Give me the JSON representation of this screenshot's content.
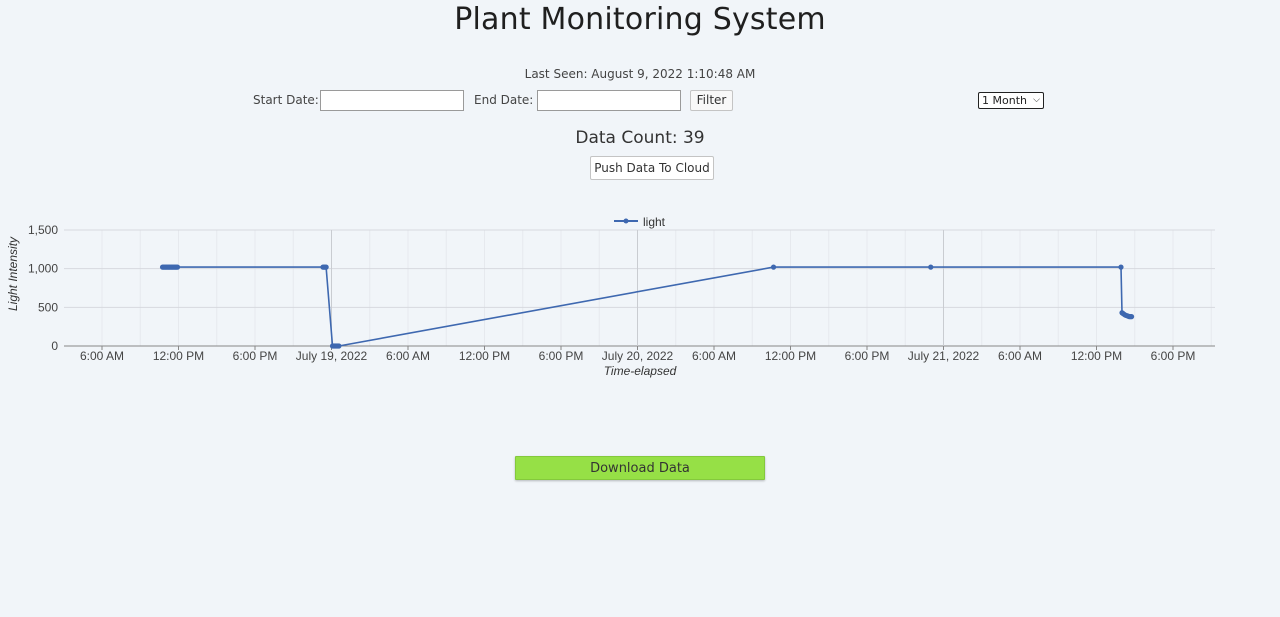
{
  "header": {
    "title": "Plant Monitoring System",
    "last_seen": "Last Seen: August 9, 2022 1:10:48 AM"
  },
  "filters": {
    "start_label": "Start Date:",
    "end_label": "End Date:",
    "start_value": "",
    "end_value": "",
    "filter_label": "Filter",
    "range_selected": "1 Month"
  },
  "data_count": "Data Count: 39",
  "push_label": "Push Data To Cloud",
  "download_label": "Download Data",
  "colors": {
    "line": "#3e68b0",
    "download": "#96e046"
  },
  "chart_data": {
    "type": "line",
    "xlabel": "Time-elapsed",
    "ylabel": "Light Intensity",
    "ylim": [
      0,
      1500
    ],
    "yticks": [
      0,
      500,
      1000,
      1500
    ],
    "ytick_labels": [
      "0",
      "500",
      "1,000",
      "1,500"
    ],
    "xlim_hours": [
      0,
      66
    ],
    "xticks": [
      {
        "h": 6,
        "label": "6:00 AM"
      },
      {
        "h": 12,
        "label": "12:00 PM"
      },
      {
        "h": 18,
        "label": "6:00 PM"
      },
      {
        "h": 24,
        "label": "July 19, 2022",
        "major": true
      },
      {
        "h": 30,
        "label": "6:00 AM"
      },
      {
        "h": 36,
        "label": "12:00 PM"
      },
      {
        "h": 42,
        "label": "6:00 PM"
      },
      {
        "h": 48,
        "label": "July 20, 2022",
        "major": true
      },
      {
        "h": 54,
        "label": "6:00 AM"
      },
      {
        "h": 60,
        "label": "12:00 PM"
      },
      {
        "h": 66,
        "label": "6:00 PM"
      },
      {
        "h": 72,
        "label": "July 21, 2022",
        "major": true
      },
      {
        "h": 78,
        "label": "6:00 AM"
      },
      {
        "h": 84,
        "label": "12:00 PM"
      },
      {
        "h": 90,
        "label": "6:00 PM"
      }
    ],
    "legend": {
      "position": "top-center"
    },
    "series": [
      {
        "name": "light",
        "points": [
          {
            "x": "July 18, 2022 10:45 AM",
            "h": 10.75,
            "y": 1020
          },
          {
            "x": "July 18, 2022 10:50 AM",
            "h": 10.83,
            "y": 1020
          },
          {
            "x": "July 18, 2022 10:55 AM",
            "h": 10.92,
            "y": 1020
          },
          {
            "x": "July 18, 2022 11:00 AM",
            "h": 11.0,
            "y": 1020
          },
          {
            "x": "July 18, 2022 11:05 AM",
            "h": 11.08,
            "y": 1020
          },
          {
            "x": "July 18, 2022 11:10 AM",
            "h": 11.17,
            "y": 1020
          },
          {
            "x": "July 18, 2022 11:15 AM",
            "h": 11.25,
            "y": 1020
          },
          {
            "x": "July 18, 2022 11:20 AM",
            "h": 11.33,
            "y": 1020
          },
          {
            "x": "July 18, 2022 11:25 AM",
            "h": 11.42,
            "y": 1020
          },
          {
            "x": "July 18, 2022 11:30 AM",
            "h": 11.5,
            "y": 1020
          },
          {
            "x": "July 18, 2022 11:35 AM",
            "h": 11.58,
            "y": 1020
          },
          {
            "x": "July 18, 2022 11:40 AM",
            "h": 11.67,
            "y": 1020
          },
          {
            "x": "July 18, 2022 11:45 AM",
            "h": 11.75,
            "y": 1020
          },
          {
            "x": "July 18, 2022 11:50 AM",
            "h": 11.83,
            "y": 1020
          },
          {
            "x": "July 18, 2022 11:55 AM",
            "h": 11.92,
            "y": 1020
          },
          {
            "x": "July 18, 2022 11:20 PM",
            "h": 23.33,
            "y": 1020
          },
          {
            "x": "July 18, 2022 11:25 PM",
            "h": 23.42,
            "y": 1020
          },
          {
            "x": "July 18, 2022 11:30 PM",
            "h": 23.5,
            "y": 1020
          },
          {
            "x": "July 18, 2022 11:35 PM",
            "h": 23.58,
            "y": 1020
          },
          {
            "x": "July 19, 2022 12:05 AM",
            "h": 24.08,
            "y": 0
          },
          {
            "x": "July 19, 2022 12:10 AM",
            "h": 24.17,
            "y": 0
          },
          {
            "x": "July 19, 2022 12:15 AM",
            "h": 24.25,
            "y": 0
          },
          {
            "x": "July 19, 2022 12:20 AM",
            "h": 24.33,
            "y": 0
          },
          {
            "x": "July 19, 2022 12:25 AM",
            "h": 24.42,
            "y": 0
          },
          {
            "x": "July 19, 2022 12:30 AM",
            "h": 24.5,
            "y": 0
          },
          {
            "x": "July 19, 2022 12:35 AM",
            "h": 24.58,
            "y": 0
          },
          {
            "x": "July 20, 2022 10:40 AM",
            "h": 58.67,
            "y": 1020
          },
          {
            "x": "July 20, 2022 11:00 PM",
            "h": 71.0,
            "y": 1020
          },
          {
            "x": "July 21, 2022 1:55 PM",
            "h": 85.92,
            "y": 1020
          },
          {
            "x": "July 21, 2022 2:00 PM",
            "h": 86.0,
            "y": 430
          },
          {
            "x": "July 21, 2022 2:05 PM",
            "h": 86.08,
            "y": 420
          },
          {
            "x": "July 21, 2022 2:10 PM",
            "h": 86.17,
            "y": 410
          },
          {
            "x": "July 21, 2022 2:15 PM",
            "h": 86.25,
            "y": 400
          },
          {
            "x": "July 21, 2022 2:20 PM",
            "h": 86.33,
            "y": 395
          },
          {
            "x": "July 21, 2022 2:25 PM",
            "h": 86.42,
            "y": 390
          },
          {
            "x": "July 21, 2022 2:30 PM",
            "h": 86.5,
            "y": 385
          },
          {
            "x": "July 21, 2022 2:35 PM",
            "h": 86.58,
            "y": 380
          },
          {
            "x": "July 21, 2022 2:40 PM",
            "h": 86.67,
            "y": 380
          },
          {
            "x": "July 21, 2022 2:45 PM",
            "h": 86.75,
            "y": 380
          }
        ]
      }
    ]
  }
}
